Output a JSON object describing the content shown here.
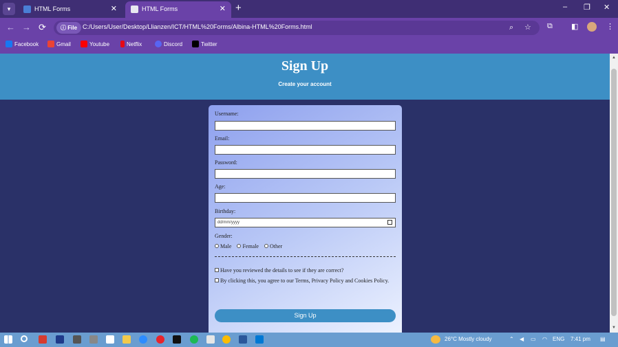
{
  "browser": {
    "tabs": [
      {
        "title": "HTML Forms"
      },
      {
        "title": "HTML Forms"
      }
    ],
    "new_tab_label": "+",
    "window_controls": {
      "minimize": "–",
      "restore": "❐",
      "close": "✕"
    },
    "nav": {
      "back": "←",
      "forward": "→",
      "reload": "⟳"
    },
    "address": {
      "scheme_chip": "File",
      "url": "C:/Users/User/Desktop/Llianzen/ICT/HTML%20Forms/Albina-HTML%20Forms.html"
    },
    "bookmarks": [
      {
        "label": "Facebook",
        "icon": "facebook-icon",
        "color": "#1877f2"
      },
      {
        "label": "Gmail",
        "icon": "gmail-icon",
        "color": "#ea4335"
      },
      {
        "label": "Youtube",
        "icon": "youtube-icon",
        "color": "#ff0000"
      },
      {
        "label": "Netflix",
        "icon": "netflix-icon",
        "color": "#e50914"
      },
      {
        "label": "Discord",
        "icon": "discord-icon",
        "color": "#5865f2"
      },
      {
        "label": "Twitter",
        "icon": "x-icon",
        "color": "#000000"
      }
    ]
  },
  "page": {
    "header": {
      "title": "Sign Up",
      "subtitle": "Create your account"
    },
    "form": {
      "fields": [
        {
          "label": "Username:",
          "value": ""
        },
        {
          "label": "Email:",
          "value": ""
        },
        {
          "label": "Password:",
          "value": ""
        },
        {
          "label": "Age:",
          "value": ""
        },
        {
          "label": "Birthday:",
          "value": "dd/mm/yyyy"
        }
      ],
      "gender": {
        "label": "Gender:",
        "options": [
          "Male",
          "Female",
          "Other"
        ]
      },
      "checks": [
        "Have you reviewed the details to see if they are correct?",
        "By clicking this, you agree to our Terms, Privacy Policy and Cookies Policy."
      ],
      "submit_label": "Sign Up"
    }
  },
  "taskbar": {
    "weather": "26°C  Mostly cloudy",
    "language": "ENG",
    "time": "7:41 pm"
  },
  "colors": {
    "header": "#3d8fc5",
    "page_bg": "#2a3168",
    "browser_frame": "#6a42a8",
    "taskbar": "#6a9dd0"
  }
}
